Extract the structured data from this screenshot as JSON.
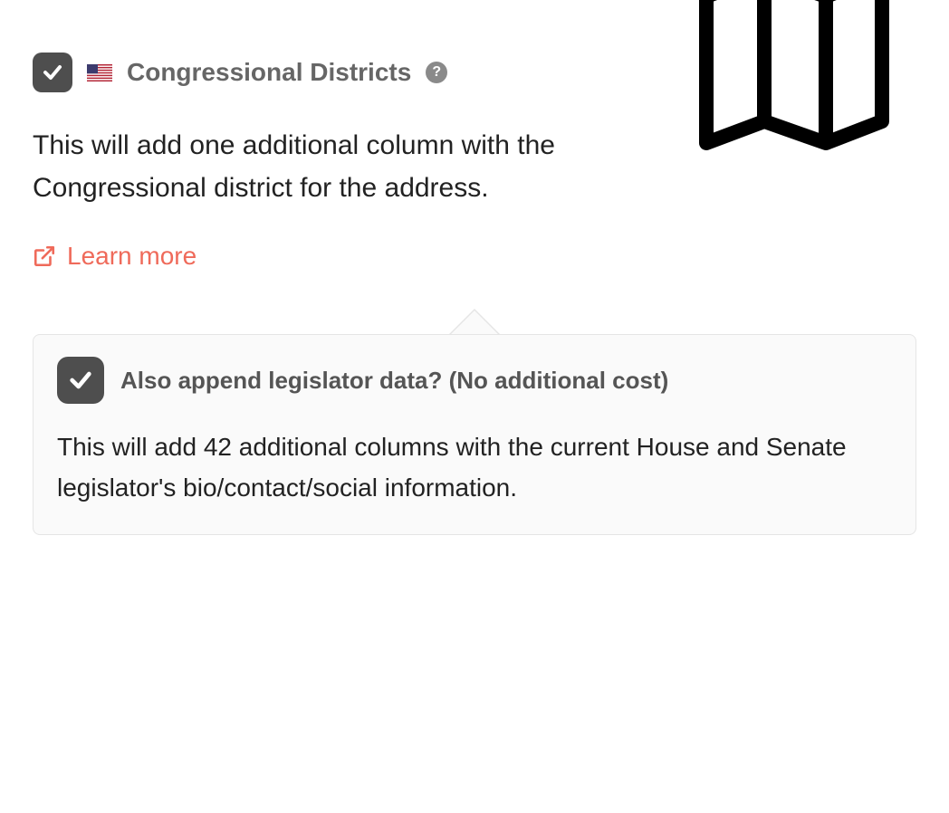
{
  "main": {
    "title": "Congressional Districts",
    "description": "This will add one additional column with the Congressional district for the address.",
    "learn_more_label": "Learn more",
    "help_glyph": "?"
  },
  "sub": {
    "title": "Also append legislator data? (No additional cost)",
    "description": "This will add 42 additional columns with the current House and Senate legislator's bio/contact/social information."
  }
}
